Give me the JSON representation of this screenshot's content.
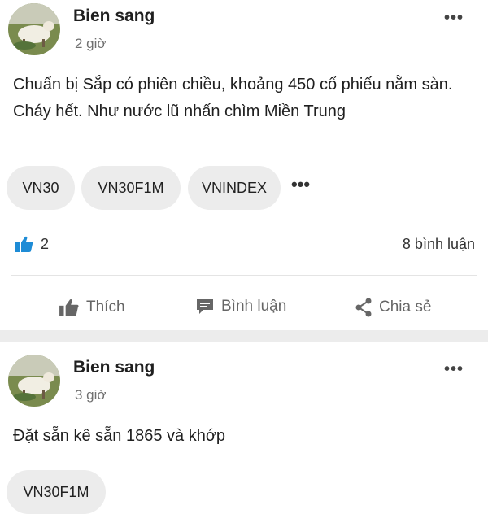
{
  "posts": [
    {
      "author": "Bien sang",
      "time": "2 giờ",
      "content": "Chuẩn bị Sắp có phiên  chiều, khoảng 450 cổ phiếu nằm sàn. Cháy hết. Như nước lũ nhấn chìm Miền Trung",
      "tags": [
        "VN30",
        "VN30F1M",
        "VNINDEX"
      ],
      "likes": "2",
      "comments": "8 bình luận",
      "actions": {
        "like": "Thích",
        "comment": "Bình luận",
        "share": "Chia sẻ"
      },
      "icons": {
        "more": "more-dots-icon",
        "like": "thumbs-up-icon"
      }
    },
    {
      "author": "Bien sang",
      "time": "3 giờ",
      "content": "Đặt sẵn kê sẵn 1865 và khớp",
      "tags": [
        "VN30F1M"
      ]
    }
  ],
  "colors": {
    "accent": "#1e8cd6",
    "chip_bg": "#ececec",
    "separator": "#ececec"
  }
}
